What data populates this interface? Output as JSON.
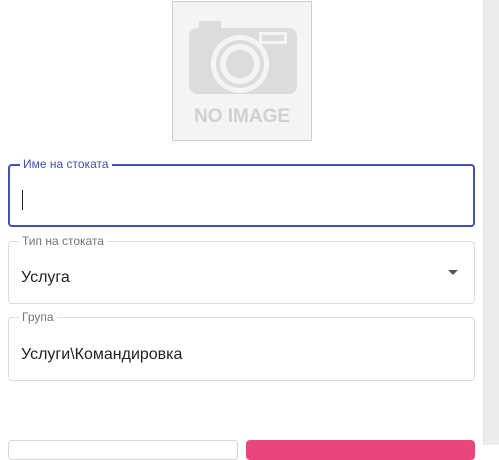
{
  "product_image": {
    "text": "NO IMAGE",
    "icon": "camera-icon"
  },
  "fields": {
    "name": {
      "label": "Име на стоката",
      "value": ""
    },
    "type": {
      "label": "Тип на стоката",
      "value": "Услуга"
    },
    "group": {
      "label": "Група",
      "value": "Услуги\\Командировка"
    }
  },
  "colors": {
    "focus": "#3f51b5",
    "accent": "#e8467c"
  }
}
